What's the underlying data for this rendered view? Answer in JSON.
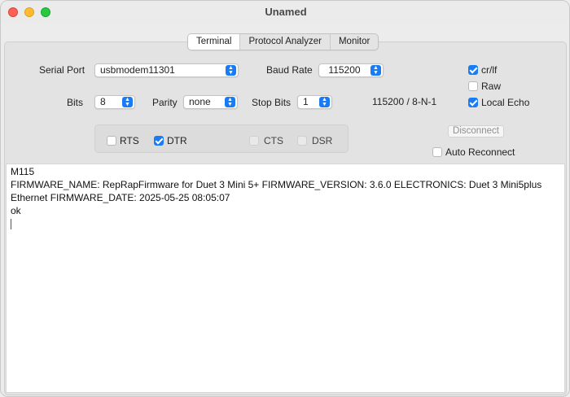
{
  "window": {
    "title": "Unamed"
  },
  "tabs": [
    "Terminal",
    "Protocol Analyzer",
    "Monitor"
  ],
  "settings": {
    "serial_port_label": "Serial Port",
    "serial_port_value": "usbmodem11301",
    "baud_rate_label": "Baud Rate",
    "baud_rate_value": "115200",
    "bits_label": "Bits",
    "bits_value": "8",
    "parity_label": "Parity",
    "parity_value": "none",
    "stop_bits_label": "Stop Bits",
    "stop_bits_value": "1",
    "summary": "115200 / 8-N-1"
  },
  "options": {
    "crlf_label": "cr/lf",
    "crlf_checked": true,
    "raw_label": "Raw",
    "raw_checked": false,
    "local_echo_label": "Local Echo",
    "local_echo_checked": true,
    "auto_reconnect_label": "Auto Reconnect",
    "auto_reconnect_checked": false,
    "disconnect_label": "Disconnect"
  },
  "signals": {
    "rts_label": "RTS",
    "rts_checked": false,
    "dtr_label": "DTR",
    "dtr_checked": true,
    "cts_label": "CTS",
    "cts_checked": false,
    "dsr_label": "DSR",
    "dsr_checked": false
  },
  "terminal": {
    "lines": [
      "M115",
      "FIRMWARE_NAME: RepRapFirmware for Duet 3 Mini 5+ FIRMWARE_VERSION: 3.6.0 ELECTRONICS: Duet 3 Mini5plus Ethernet FIRMWARE_DATE: 2025-05-25 08:05:07",
      "ok"
    ]
  },
  "colors": {
    "accent": "#1a7cf5",
    "close": "#fe5f57",
    "minimize": "#febc2e",
    "maximize": "#28c840"
  }
}
